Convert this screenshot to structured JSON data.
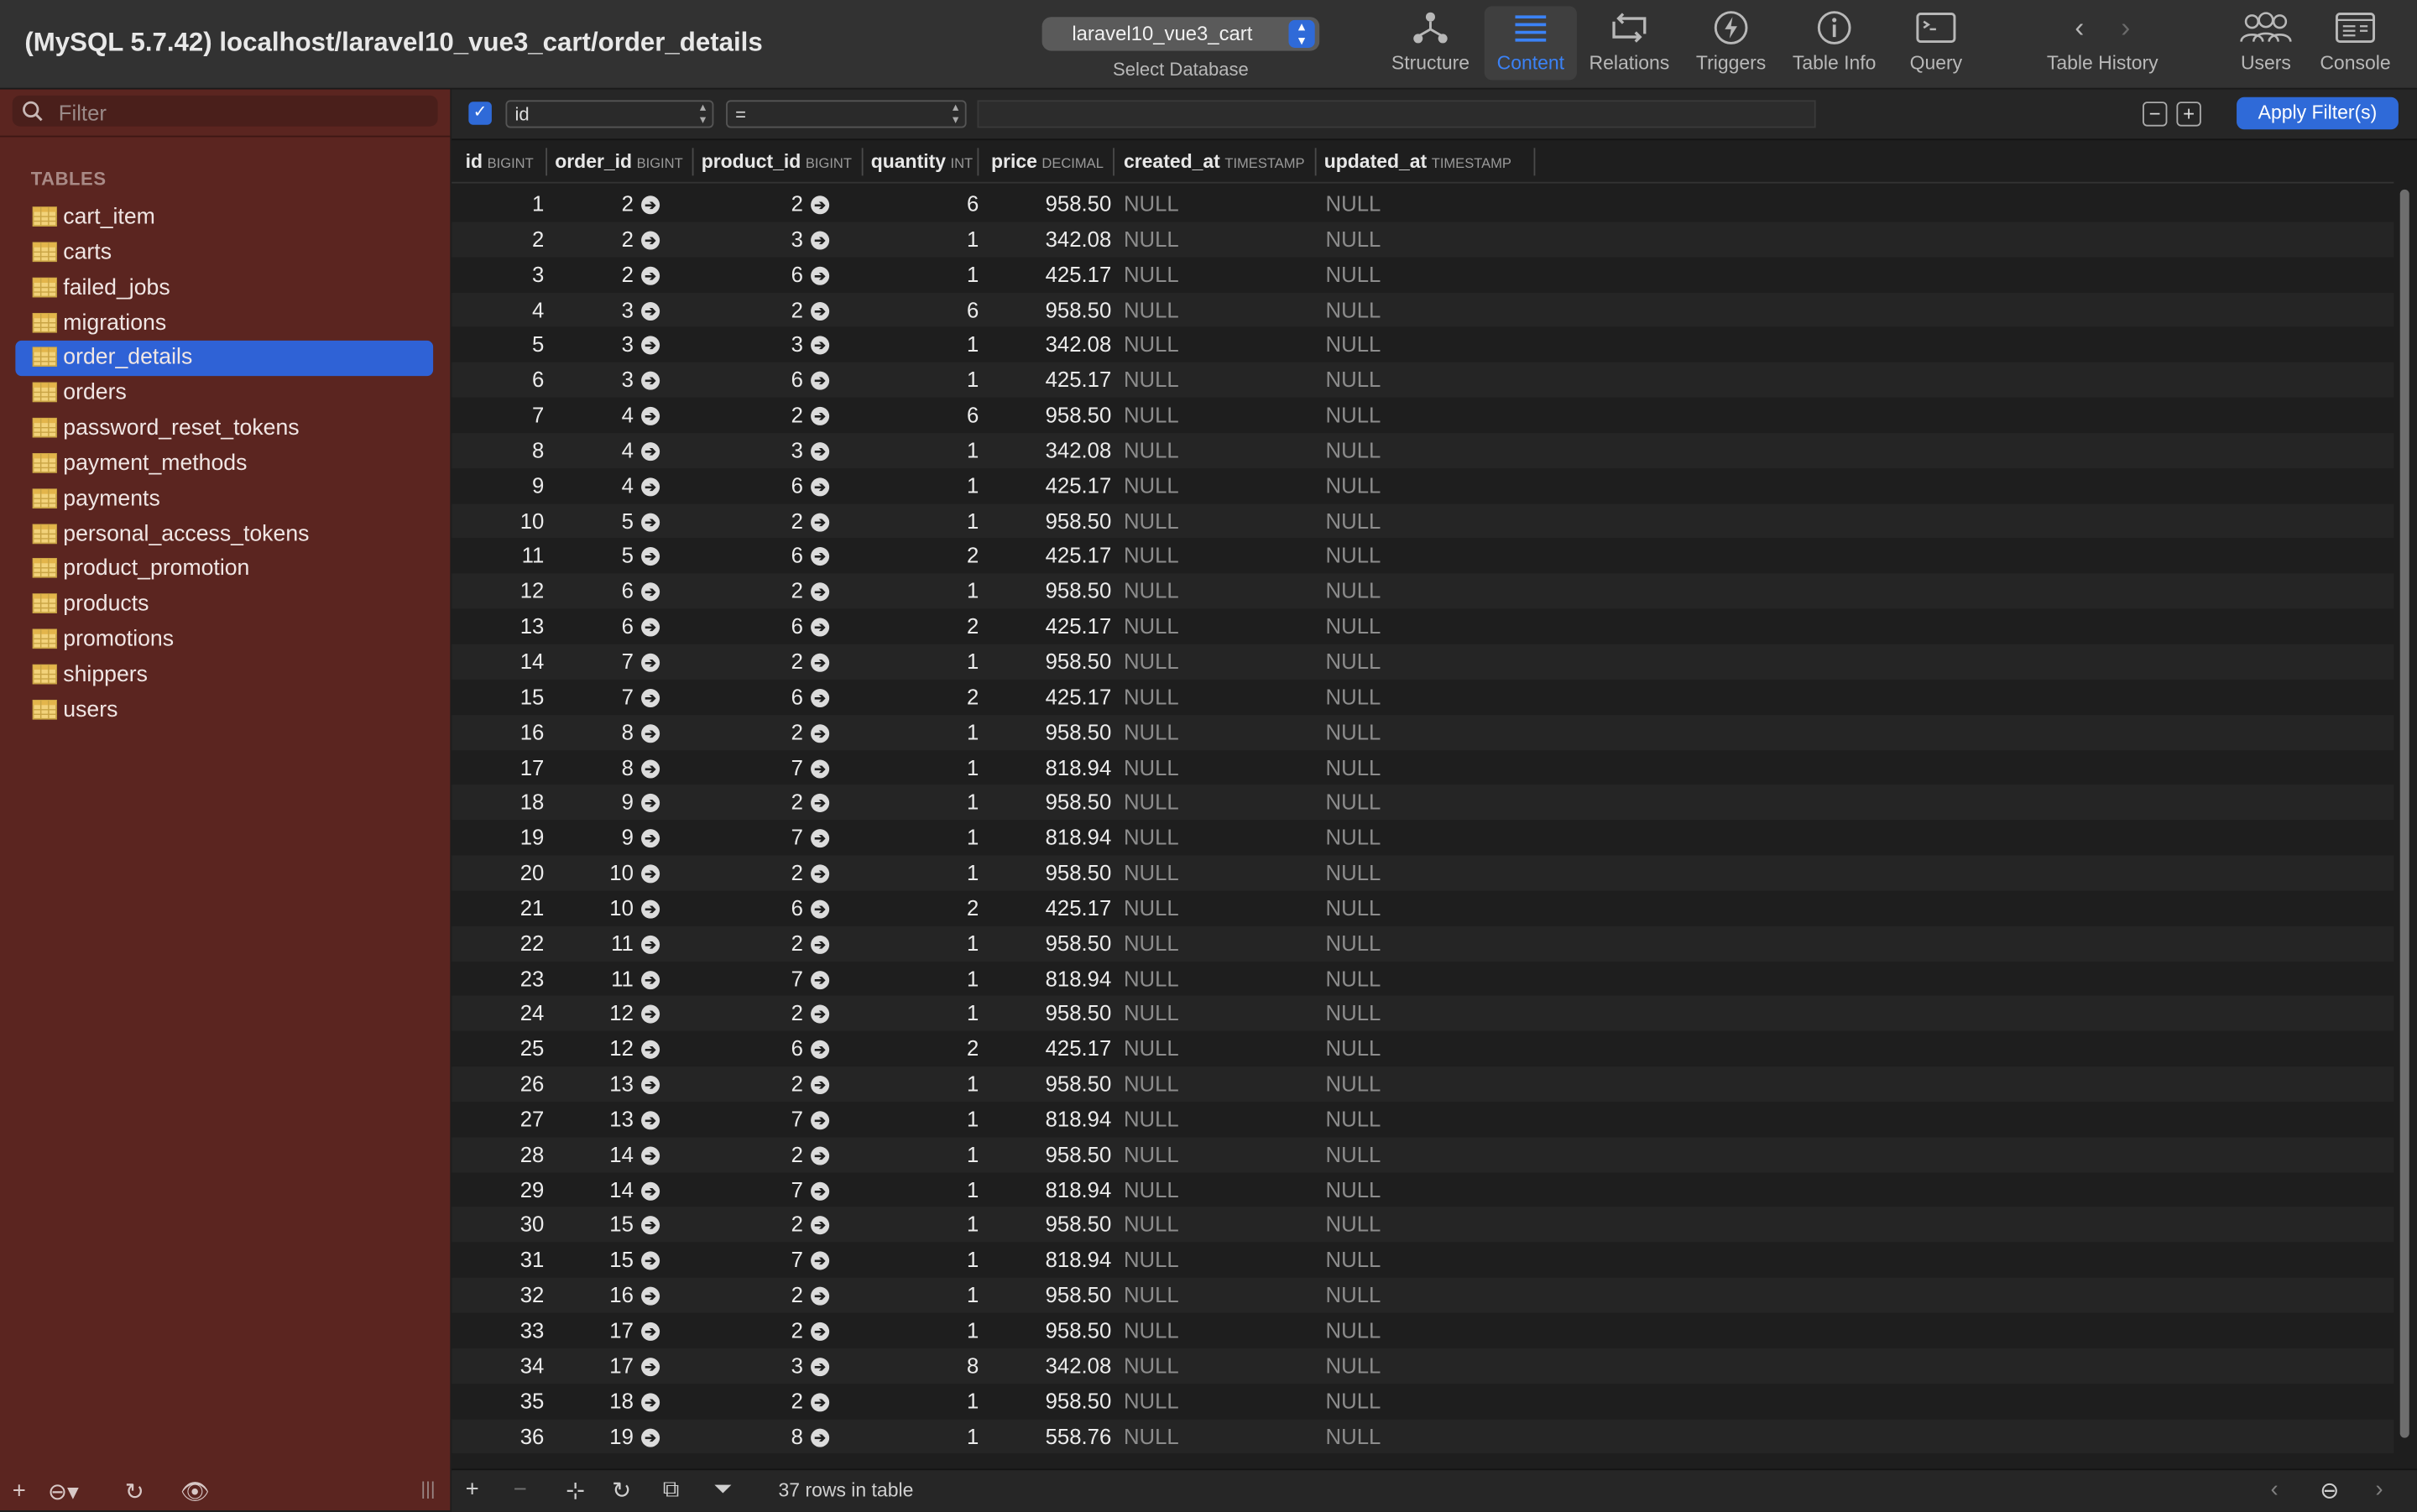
{
  "window": {
    "title": "(MySQL 5.7.42) localhost/laravel10_vue3_cart/order_details"
  },
  "toolbar": {
    "database": "laravel10_vue3_cart",
    "database_caption": "Select Database",
    "structure": "Structure",
    "content": "Content",
    "relations": "Relations",
    "triggers": "Triggers",
    "table_info": "Table Info",
    "query": "Query",
    "table_history": "Table History",
    "users": "Users",
    "console": "Console"
  },
  "sidebar": {
    "filter_placeholder": "Filter",
    "heading": "TABLES",
    "selected": "order_details",
    "tables": [
      "cart_item",
      "carts",
      "failed_jobs",
      "migrations",
      "order_details",
      "orders",
      "password_reset_tokens",
      "payment_methods",
      "payments",
      "personal_access_tokens",
      "product_promotion",
      "products",
      "promotions",
      "shippers",
      "users"
    ]
  },
  "filter_bar": {
    "column": "id",
    "operator": "=",
    "value": "",
    "apply_label": "Apply Filter(s)"
  },
  "columns": [
    {
      "name": "id",
      "type": "BIGINT"
    },
    {
      "name": "order_id",
      "type": "BIGINT"
    },
    {
      "name": "product_id",
      "type": "BIGINT"
    },
    {
      "name": "quantity",
      "type": "INT"
    },
    {
      "name": "price",
      "type": "DECIMAL"
    },
    {
      "name": "created_at",
      "type": "TIMESTAMP"
    },
    {
      "name": "updated_at",
      "type": "TIMESTAMP"
    }
  ],
  "rows": [
    [
      "1",
      "2",
      "2",
      "6",
      "958.50",
      "NULL",
      "NULL"
    ],
    [
      "2",
      "2",
      "3",
      "1",
      "342.08",
      "NULL",
      "NULL"
    ],
    [
      "3",
      "2",
      "6",
      "1",
      "425.17",
      "NULL",
      "NULL"
    ],
    [
      "4",
      "3",
      "2",
      "6",
      "958.50",
      "NULL",
      "NULL"
    ],
    [
      "5",
      "3",
      "3",
      "1",
      "342.08",
      "NULL",
      "NULL"
    ],
    [
      "6",
      "3",
      "6",
      "1",
      "425.17",
      "NULL",
      "NULL"
    ],
    [
      "7",
      "4",
      "2",
      "6",
      "958.50",
      "NULL",
      "NULL"
    ],
    [
      "8",
      "4",
      "3",
      "1",
      "342.08",
      "NULL",
      "NULL"
    ],
    [
      "9",
      "4",
      "6",
      "1",
      "425.17",
      "NULL",
      "NULL"
    ],
    [
      "10",
      "5",
      "2",
      "1",
      "958.50",
      "NULL",
      "NULL"
    ],
    [
      "11",
      "5",
      "6",
      "2",
      "425.17",
      "NULL",
      "NULL"
    ],
    [
      "12",
      "6",
      "2",
      "1",
      "958.50",
      "NULL",
      "NULL"
    ],
    [
      "13",
      "6",
      "6",
      "2",
      "425.17",
      "NULL",
      "NULL"
    ],
    [
      "14",
      "7",
      "2",
      "1",
      "958.50",
      "NULL",
      "NULL"
    ],
    [
      "15",
      "7",
      "6",
      "2",
      "425.17",
      "NULL",
      "NULL"
    ],
    [
      "16",
      "8",
      "2",
      "1",
      "958.50",
      "NULL",
      "NULL"
    ],
    [
      "17",
      "8",
      "7",
      "1",
      "818.94",
      "NULL",
      "NULL"
    ],
    [
      "18",
      "9",
      "2",
      "1",
      "958.50",
      "NULL",
      "NULL"
    ],
    [
      "19",
      "9",
      "7",
      "1",
      "818.94",
      "NULL",
      "NULL"
    ],
    [
      "20",
      "10",
      "2",
      "1",
      "958.50",
      "NULL",
      "NULL"
    ],
    [
      "21",
      "10",
      "6",
      "2",
      "425.17",
      "NULL",
      "NULL"
    ],
    [
      "22",
      "11",
      "2",
      "1",
      "958.50",
      "NULL",
      "NULL"
    ],
    [
      "23",
      "11",
      "7",
      "1",
      "818.94",
      "NULL",
      "NULL"
    ],
    [
      "24",
      "12",
      "2",
      "1",
      "958.50",
      "NULL",
      "NULL"
    ],
    [
      "25",
      "12",
      "6",
      "2",
      "425.17",
      "NULL",
      "NULL"
    ],
    [
      "26",
      "13",
      "2",
      "1",
      "958.50",
      "NULL",
      "NULL"
    ],
    [
      "27",
      "13",
      "7",
      "1",
      "818.94",
      "NULL",
      "NULL"
    ],
    [
      "28",
      "14",
      "2",
      "1",
      "958.50",
      "NULL",
      "NULL"
    ],
    [
      "29",
      "14",
      "7",
      "1",
      "818.94",
      "NULL",
      "NULL"
    ],
    [
      "30",
      "15",
      "2",
      "1",
      "958.50",
      "NULL",
      "NULL"
    ],
    [
      "31",
      "15",
      "7",
      "1",
      "818.94",
      "NULL",
      "NULL"
    ],
    [
      "32",
      "16",
      "2",
      "1",
      "958.50",
      "NULL",
      "NULL"
    ],
    [
      "33",
      "17",
      "2",
      "1",
      "958.50",
      "NULL",
      "NULL"
    ],
    [
      "34",
      "17",
      "3",
      "8",
      "342.08",
      "NULL",
      "NULL"
    ],
    [
      "35",
      "18",
      "2",
      "1",
      "958.50",
      "NULL",
      "NULL"
    ],
    [
      "36",
      "19",
      "8",
      "1",
      "558.76",
      "NULL",
      "NULL"
    ]
  ],
  "status": {
    "text": "37 rows in table"
  },
  "colors": {
    "accent": "#2f6ad8",
    "sidebar_bg": "#5b2520",
    "null_text": "#8d8d8d"
  }
}
